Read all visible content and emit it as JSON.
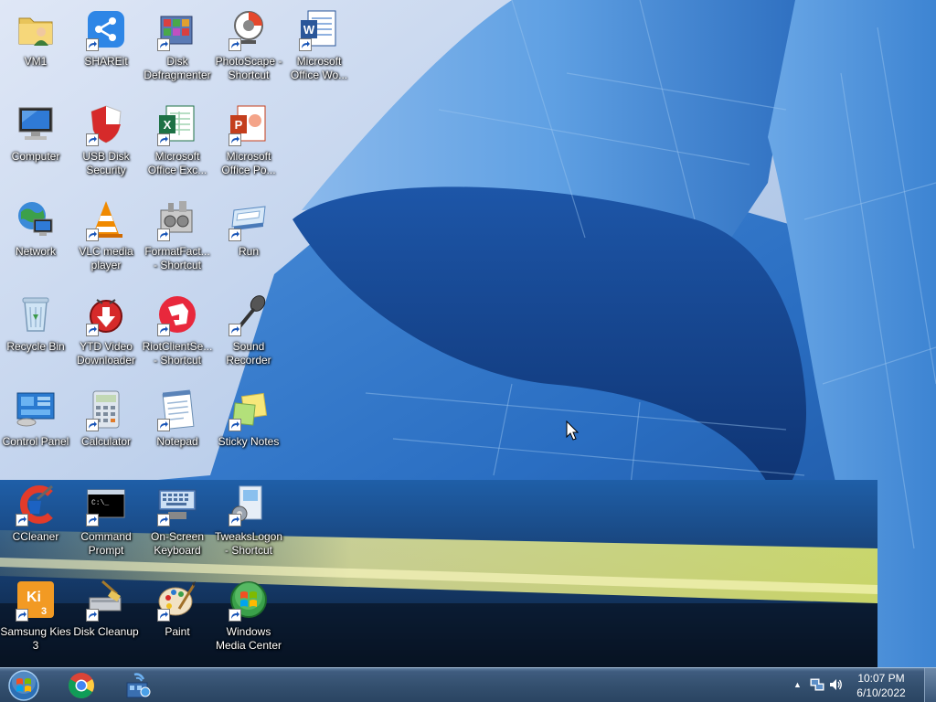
{
  "desktop": {
    "icons": [
      {
        "name": "VM1",
        "icon": "folder-user-icon",
        "shortcut": false
      },
      {
        "name": "SHAREit",
        "icon": "shareit-icon",
        "shortcut": true
      },
      {
        "name": "Disk\nDefragmenter",
        "icon": "disk-defragmenter-icon",
        "shortcut": true
      },
      {
        "name": "PhotoScape -\nShortcut",
        "icon": "photoscape-icon",
        "shortcut": true
      },
      {
        "name": "Microsoft\nOffice Wo...",
        "icon": "word-icon",
        "shortcut": true
      },
      {
        "name": "Computer",
        "icon": "computer-icon",
        "shortcut": false
      },
      {
        "name": "USB Disk\nSecurity",
        "icon": "shield-icon",
        "shortcut": true
      },
      {
        "name": "Microsoft\nOffice Exc...",
        "icon": "excel-icon",
        "shortcut": true
      },
      {
        "name": "Microsoft\nOffice Po...",
        "icon": "powerpoint-icon",
        "shortcut": true
      },
      {
        "name": "Network",
        "icon": "network-icon",
        "shortcut": false
      },
      {
        "name": "VLC media\nplayer",
        "icon": "vlc-icon",
        "shortcut": true
      },
      {
        "name": "FormatFact...\n- Shortcut",
        "icon": "format-factory-icon",
        "shortcut": true
      },
      {
        "name": "Run",
        "icon": "run-icon",
        "shortcut": true
      },
      {
        "name": "Recycle Bin",
        "icon": "recycle-bin-icon",
        "shortcut": false
      },
      {
        "name": "YTD Video\nDownloader",
        "icon": "ytd-icon",
        "shortcut": true
      },
      {
        "name": "RiotClientSe...\n- Shortcut",
        "icon": "riot-client-icon",
        "shortcut": true
      },
      {
        "name": "Sound\nRecorder",
        "icon": "microphone-icon",
        "shortcut": true
      },
      {
        "name": "Control Panel",
        "icon": "control-panel-icon",
        "shortcut": false
      },
      {
        "name": "Calculator",
        "icon": "calculator-icon",
        "shortcut": true
      },
      {
        "name": "Notepad",
        "icon": "notepad-icon",
        "shortcut": true
      },
      {
        "name": "Sticky Notes",
        "icon": "sticky-notes-icon",
        "shortcut": true
      },
      {
        "name": "CCleaner",
        "icon": "ccleaner-icon",
        "shortcut": true
      },
      {
        "name": "Command\nPrompt",
        "icon": "command-prompt-icon",
        "shortcut": true
      },
      {
        "name": "On-Screen\nKeyboard",
        "icon": "keyboard-icon",
        "shortcut": true
      },
      {
        "name": "TweaksLogon\n- Shortcut",
        "icon": "tweakslogon-icon",
        "shortcut": true
      },
      {
        "name": "Samsung Kies\n3",
        "icon": "samsung-kies-icon",
        "shortcut": true
      },
      {
        "name": "Disk Cleanup",
        "icon": "disk-cleanup-icon",
        "shortcut": true
      },
      {
        "name": "Paint",
        "icon": "paint-icon",
        "shortcut": true
      },
      {
        "name": "Windows\nMedia Center",
        "icon": "media-center-icon",
        "shortcut": true
      }
    ]
  },
  "taskbar": {
    "start": {
      "icon": "windows-start-icon"
    },
    "pinned": [
      {
        "icon": "chrome-icon"
      },
      {
        "icon": "network-tool-icon"
      }
    ],
    "tray": {
      "icons": [
        "show-hidden-icons-icon",
        "network-icon",
        "volume-icon"
      ]
    },
    "clock": {
      "time": "10:07 PM",
      "date": "6/10/2022"
    }
  },
  "colors": {
    "sky": "#a9c4e6",
    "building": "#1f5fb0",
    "taskbar": "#34506f"
  }
}
